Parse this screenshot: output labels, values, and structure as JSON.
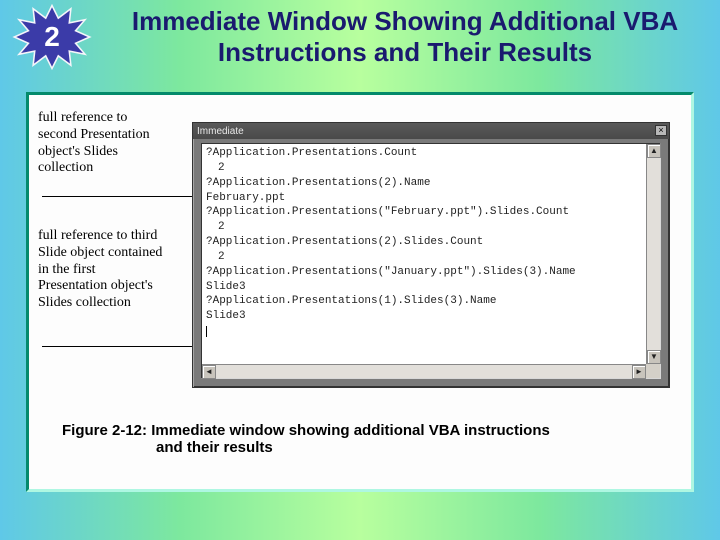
{
  "burst_number": "2",
  "title": "Immediate Window Showing Additional VBA Instructions and Their Results",
  "annotations": {
    "a1": "full reference to second Presentation object's Slides collection",
    "a2": "full reference to third Slide object contained in the first Presentation object's Slides collection"
  },
  "immediate_window": {
    "title": "Immediate",
    "close_glyph": "×",
    "lines": [
      {
        "text": "?Application.Presentations.Count",
        "result": false
      },
      {
        "text": "2",
        "result": true
      },
      {
        "text": "?Application.Presentations(2).Name",
        "result": false
      },
      {
        "text": "February.ppt",
        "result": false
      },
      {
        "text": "?Application.Presentations(\"February.ppt\").Slides.Count",
        "result": false
      },
      {
        "text": "2",
        "result": true
      },
      {
        "text": "?Application.Presentations(2).Slides.Count",
        "result": false
      },
      {
        "text": "2",
        "result": true
      },
      {
        "text": "?Application.Presentations(\"January.ppt\").Slides(3).Name",
        "result": false
      },
      {
        "text": "Slide3",
        "result": false
      },
      {
        "text": "?Application.Presentations(1).Slides(3).Name",
        "result": false
      },
      {
        "text": "Slide3",
        "result": false
      }
    ],
    "scroll_left": "◄",
    "scroll_right": "►",
    "scroll_up": "▲",
    "scroll_down": "▼"
  },
  "caption": {
    "label": "Figure 2-12:",
    "text_l1": "  Immediate window showing additional VBA instructions",
    "text_l2": "and their results"
  }
}
